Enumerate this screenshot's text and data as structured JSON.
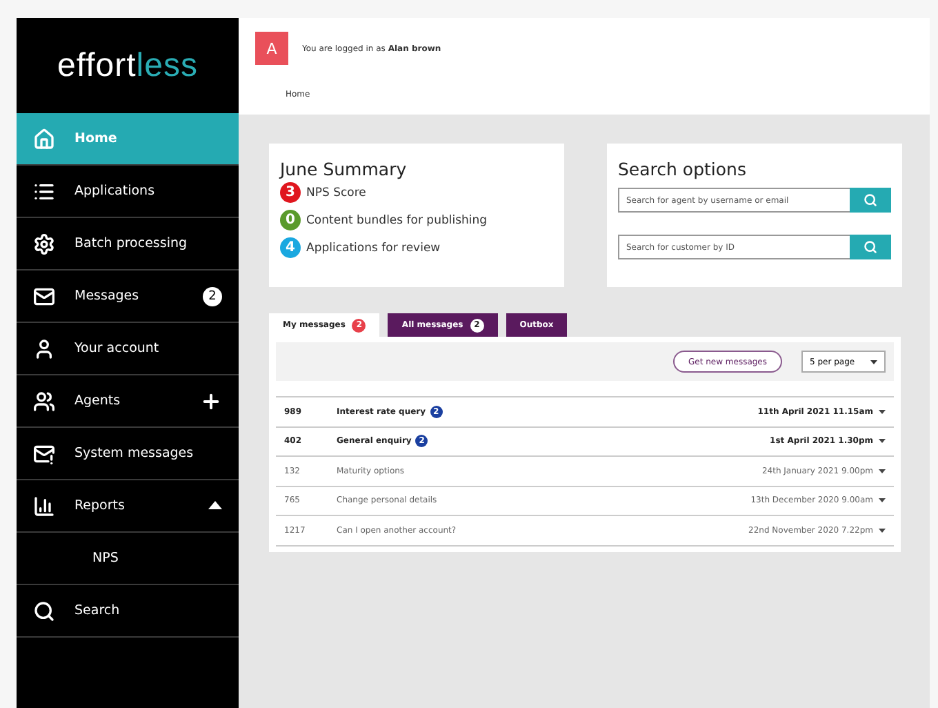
{
  "logo": {
    "part_1": "effort",
    "part_2": "less"
  },
  "sidebar": {
    "items": [
      {
        "label": "Home",
        "selected": true
      },
      {
        "label": "Applications",
        "selected": false
      },
      {
        "label": "Batch processing",
        "selected": false
      },
      {
        "label": "Messages",
        "selected": false,
        "badge": "2"
      },
      {
        "label": "Your account",
        "selected": false
      },
      {
        "label": "Agents",
        "selected": false,
        "expanded": false
      },
      {
        "label": "System messages",
        "selected": false
      },
      {
        "label": "Reports",
        "selected": false,
        "expanded": true,
        "children": [
          {
            "label": "NPS",
            "selected": false
          }
        ]
      },
      {
        "label": "Search",
        "selected": false
      }
    ]
  },
  "header": {
    "avatar": "A",
    "login_text": "You are logged in as",
    "user": "Alan brown",
    "breadcrumb": "Home"
  },
  "summary": {
    "title": "June Summary",
    "items": [
      {
        "count": "3",
        "label": "NPS Score",
        "color": "#e0161e"
      },
      {
        "count": "0",
        "label": "Content bundles for publishing",
        "color": "#5a9a2c"
      },
      {
        "count": "4",
        "label": "Applications for review",
        "color": "#1aa8e0"
      }
    ]
  },
  "search_options": {
    "title": "Search options",
    "fields": [
      {
        "placeholder": "Search for agent by username or email"
      },
      {
        "placeholder": "Search for customer by ID"
      }
    ]
  },
  "tabs": [
    {
      "label": "My messages",
      "badge": "2",
      "selected": true
    },
    {
      "label": "All messages",
      "badge": "2",
      "selected": false
    },
    {
      "label": "Outbox",
      "selected": false
    }
  ],
  "toolbar": {
    "button": "Get new messages",
    "page_size": "5 per page"
  },
  "messages": [
    {
      "id": "989",
      "subject": "Interest rate query",
      "badge": "2",
      "date": "11th April 2021 11.15am",
      "unread": true
    },
    {
      "id": "402",
      "subject": "General enquiry",
      "badge": "2",
      "date": "1st April 2021 1.30pm",
      "unread": true
    },
    {
      "id": "132",
      "subject": "Maturity options",
      "date": "24th January 2021 9.00pm",
      "unread": false
    },
    {
      "id": "765",
      "subject": "Change personal details",
      "date": "13th December 2020 9.00am",
      "unread": false
    },
    {
      "id": "1217",
      "subject": "Can I open another account?",
      "date": "22nd November 2020 7.22pm",
      "unread": false
    }
  ]
}
